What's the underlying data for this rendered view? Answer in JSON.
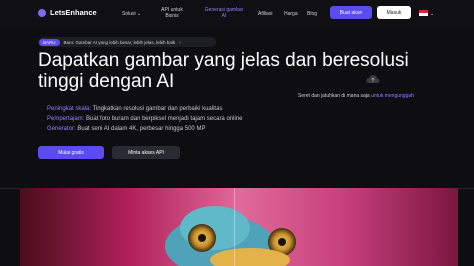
{
  "nav": {
    "logo_text": "LetsEnhance",
    "items": [
      {
        "label": "Solusi"
      },
      {
        "label_line1": "API untuk",
        "label_line2": "Bisnis"
      },
      {
        "label_line1": "Generasi gambar",
        "label_line2": "AI"
      },
      {
        "label": "Afiliasi"
      },
      {
        "label": "Harga"
      },
      {
        "label": "Blog"
      }
    ],
    "signup_label": "Buat akun",
    "login_label": "Masuk",
    "language_flag": "id-flag-icon"
  },
  "banner": {
    "badge": "BARU",
    "text": "Baru: Gambar AI yang lebih besar, lebih jelas, lebih baik"
  },
  "hero": {
    "headline_line1": "Dapatkan gambar yang jelas dan beresolusi",
    "headline_line2": "tinggi dengan AI",
    "features": [
      {
        "key": "Peningkat skala:",
        "text": "Tingkatkan resolusi gambar dan perbaiki kualitas"
      },
      {
        "key": "Pempertajam:",
        "text": "Buat foto buram dan berpiksel menjadi tajam secara online"
      },
      {
        "key": "Generator:",
        "text": "Buat seni AI dalam 4K, perbesar hingga 500 MP"
      }
    ],
    "cta_primary": "Mulai gratis",
    "cta_secondary": "Minta akses API"
  },
  "upload": {
    "text": "Seret dan jatuhkan di mana saja",
    "link": "untuk mengunggah"
  },
  "colors": {
    "accent": "#5b4cf0",
    "accent_text": "#8f82ff",
    "background": "#0d0d12"
  }
}
